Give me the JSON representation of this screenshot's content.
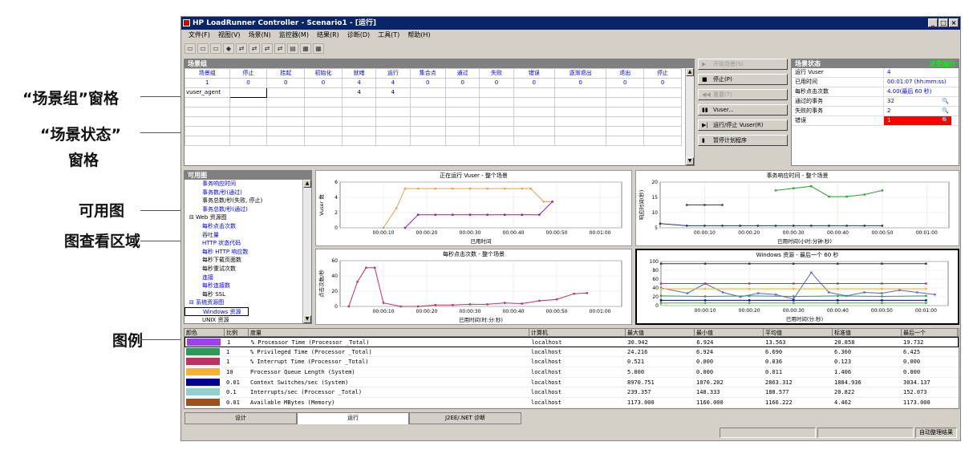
{
  "annotations": [
    {
      "text": "“场景组”窗格"
    },
    {
      "text": "“场景状态”"
    },
    {
      "text": "窗格"
    },
    {
      "text": "可用图"
    },
    {
      "text": "图查看区域"
    },
    {
      "text": "图例"
    }
  ],
  "window": {
    "title": "HP LoadRunner Controller - Scenario1 - [运行]",
    "min": "_",
    "max": "□",
    "close": "×"
  },
  "menu": [
    "文件(F)",
    "视图(V)",
    "场景(N)",
    "监控器(M)",
    "结果(R)",
    "诊断(D)",
    "工具(T)",
    "帮助(H)"
  ],
  "toolbar": [
    "▭",
    "▭",
    "▭",
    "◆",
    "⇄",
    "⇄",
    "⇄",
    "⇄",
    "▤",
    "▦",
    "▦"
  ],
  "groups": {
    "title": "场景组",
    "headers": [
      "场景组",
      "停止",
      "挂起",
      "初始化",
      "就绪",
      "运行",
      "集合点",
      "通过",
      "失败",
      "错误",
      "逐渐退出",
      "退出",
      "停止"
    ],
    "counts": [
      "1",
      "0",
      "0",
      "0",
      "4",
      "4",
      "0",
      "0",
      "0",
      "0",
      "0",
      "0",
      "0"
    ],
    "row": [
      "vuser_agent",
      "",
      "",
      "",
      "4",
      "4",
      "",
      "",
      "",
      "",
      "",
      "",
      ""
    ]
  },
  "controls": [
    {
      "icon": "▶",
      "label": "开始场景(S)",
      "disabled": true
    },
    {
      "icon": "■",
      "label": "停止(P)",
      "disabled": false
    },
    {
      "icon": "◀◀",
      "label": "重置(T)",
      "disabled": true
    },
    {
      "icon": "▮▮",
      "label": "Vuser...",
      "disabled": false
    },
    {
      "icon": "▶|",
      "label": "运行/停止 Vuser(R)",
      "disabled": false
    },
    {
      "icon": "▮",
      "label": "暂停计划程序",
      "disabled": false
    }
  ],
  "status": {
    "title": "场景状态",
    "state": "正在运行",
    "rows": [
      {
        "k": "运行 Vuser",
        "v": "4",
        "mag": ""
      },
      {
        "k": "已用时间",
        "v": "00:01:07 (hh:mm:ss)",
        "mag": ""
      },
      {
        "k": "每秒点击次数",
        "v": "4.00(最后 60 秒)",
        "mag": ""
      },
      {
        "k": "通过的事务",
        "v": "32",
        "mag": "🔍"
      },
      {
        "k": "失败的事务",
        "v": "2",
        "mag": "🔍"
      },
      {
        "k": "错误",
        "v": "1",
        "mag": "🔍",
        "red": true
      }
    ]
  },
  "graphs": {
    "title": "可用图",
    "items": [
      {
        "t": "事务响应时间",
        "c": "b",
        "i": 1
      },
      {
        "t": "事务数/秒(通过)",
        "c": "b",
        "i": 1
      },
      {
        "t": "事务总数/秒(失败, 停止)",
        "c": "k",
        "i": 1
      },
      {
        "t": "事务总数/秒(通过)",
        "c": "b",
        "i": 1
      },
      {
        "t": "⊟ Web 资源图",
        "c": "h",
        "i": 0
      },
      {
        "t": "每秒点击次数",
        "c": "b",
        "i": 1
      },
      {
        "t": "吞吐量",
        "c": "b",
        "i": 1
      },
      {
        "t": "HTTP 状态代码",
        "c": "b",
        "i": 1
      },
      {
        "t": "每秒 HTTP 响应数",
        "c": "b",
        "i": 1
      },
      {
        "t": "每秒下载页面数",
        "c": "k",
        "i": 1
      },
      {
        "t": "每秒重试次数",
        "c": "k",
        "i": 1
      },
      {
        "t": "连接",
        "c": "b",
        "i": 1
      },
      {
        "t": "每秒连接数",
        "c": "b",
        "i": 1
      },
      {
        "t": "每秒 SSL",
        "c": "k",
        "i": 1
      },
      {
        "t": "⊟ 系统资源图",
        "c": "b",
        "i": 0
      },
      {
        "t": "Windows 资源",
        "c": "b",
        "i": 1,
        "sel": true
      },
      {
        "t": "UNIX 资源",
        "c": "k",
        "i": 1
      }
    ]
  },
  "chart_data": [
    {
      "type": "line",
      "title": "正在运行 Vuser - 整个场景",
      "xlabel": "已用时间",
      "ylabel": "Vuser 数",
      "x_ticks": [
        "00:00:10",
        "00:00:20",
        "00:00:30",
        "00:00:40",
        "00:00:50",
        "00:01:00"
      ],
      "y_ticks": [
        "0",
        "2",
        "4",
        "6"
      ],
      "xlim": [
        0,
        65
      ],
      "ylim": [
        0,
        7
      ],
      "series": [
        {
          "color": "#e8a050",
          "points": [
            [
              10,
              0
            ],
            [
              13,
              3
            ],
            [
              15,
              6
            ],
            [
              18,
              6
            ],
            [
              22,
              6
            ],
            [
              26,
              6
            ],
            [
              30,
              6
            ],
            [
              34,
              6
            ],
            [
              38,
              6
            ],
            [
              42,
              6
            ],
            [
              44,
              6
            ],
            [
              47,
              4
            ],
            [
              49,
              4
            ]
          ]
        },
        {
          "color": "#8020c0",
          "points": [
            [
              15,
              0
            ],
            [
              18,
              2
            ],
            [
              22,
              2
            ],
            [
              26,
              2
            ],
            [
              30,
              2
            ],
            [
              34,
              2
            ],
            [
              38,
              2
            ],
            [
              42,
              2
            ],
            [
              46,
              2
            ],
            [
              49,
              4
            ]
          ]
        }
      ]
    },
    {
      "type": "line",
      "title": "事务响应时间 - 整个场景",
      "xlabel": "已用时间(小时:分钟:秒)",
      "ylabel": "响应时间(秒)",
      "x_ticks": [
        "00:00:10",
        "00:00:20",
        "00:00:30",
        "00:00:40",
        "00:00:50",
        "00:01:00"
      ],
      "y_ticks": [
        "5",
        "10",
        "15",
        "20"
      ],
      "xlim": [
        0,
        65
      ],
      "ylim": [
        0,
        22
      ],
      "series": [
        {
          "color": "#30a030",
          "points": [
            [
              26,
              18
            ],
            [
              30,
              19
            ],
            [
              34,
              20
            ],
            [
              38,
              15
            ],
            [
              42,
              15
            ],
            [
              46,
              16
            ],
            [
              50,
              18
            ]
          ]
        },
        {
          "color": "#404040",
          "points": [
            [
              6,
              11
            ],
            [
              10,
              11
            ],
            [
              14,
              11
            ]
          ]
        },
        {
          "color": "#203080",
          "points": [
            [
              0,
              2
            ],
            [
              6,
              1
            ],
            [
              10,
              1
            ],
            [
              14,
              1
            ],
            [
              18,
              1
            ],
            [
              22,
              1
            ],
            [
              26,
              1
            ],
            [
              30,
              1
            ],
            [
              34,
              1
            ],
            [
              38,
              1
            ],
            [
              42,
              1
            ],
            [
              46,
              1
            ],
            [
              50,
              1
            ]
          ]
        }
      ]
    },
    {
      "type": "line",
      "title": "每秒点击次数 - 整个场景",
      "xlabel": "已用时间(时:分:秒)",
      "ylabel": "点击次数/秒",
      "x_ticks": [
        "00:00:10",
        "00:00:20",
        "00:00:30",
        "00:00:40",
        "00:00:50",
        "00:01:00"
      ],
      "y_ticks": [
        "0",
        "20",
        "40",
        "60"
      ],
      "xlim": [
        0,
        65
      ],
      "ylim": [
        0,
        65
      ],
      "series": [
        {
          "color": "#c0306a",
          "points": [
            [
              2,
              0
            ],
            [
              4,
              35
            ],
            [
              6,
              55
            ],
            [
              8,
              55
            ],
            [
              10,
              5
            ],
            [
              14,
              0
            ],
            [
              18,
              0
            ],
            [
              22,
              2
            ],
            [
              26,
              2
            ],
            [
              30,
              3
            ],
            [
              34,
              3
            ],
            [
              38,
              5
            ],
            [
              42,
              4
            ],
            [
              46,
              8
            ],
            [
              50,
              10
            ],
            [
              54,
              18
            ],
            [
              57,
              19
            ]
          ]
        }
      ]
    },
    {
      "type": "line",
      "title": "Windows 资源 - 最后一个 60 秒",
      "xlabel": "已用时间(分:秒)",
      "ylabel": "",
      "x_ticks": [
        "00:00:10",
        "00:00:20",
        "00:00:30",
        "00:00:40",
        "00:00:50",
        "00:01:00"
      ],
      "y_ticks": [
        "0",
        "20",
        "40",
        "60",
        "80",
        "100"
      ],
      "xlim": [
        0,
        65
      ],
      "ylim": [
        0,
        100
      ],
      "series": [
        {
          "color": "#333333",
          "points": [
            [
              0,
              95
            ],
            [
              10,
              95
            ],
            [
              20,
              95
            ],
            [
              30,
              95
            ],
            [
              40,
              95
            ],
            [
              50,
              95
            ],
            [
              60,
              95
            ]
          ]
        },
        {
          "color": "#6060e0",
          "points": [
            [
              0,
              40
            ],
            [
              6,
              28
            ],
            [
              10,
              50
            ],
            [
              14,
              30
            ],
            [
              18,
              20
            ],
            [
              22,
              28
            ],
            [
              26,
              25
            ],
            [
              30,
              15
            ],
            [
              34,
              75
            ],
            [
              38,
              30
            ],
            [
              42,
              22
            ],
            [
              46,
              30
            ],
            [
              50,
              28
            ],
            [
              54,
              35
            ],
            [
              58,
              30
            ],
            [
              62,
              25
            ]
          ]
        },
        {
          "color": "#c03060",
          "points": [
            [
              0,
              50
            ],
            [
              10,
              50
            ],
            [
              20,
              50
            ],
            [
              30,
              50
            ],
            [
              40,
              50
            ],
            [
              50,
              50
            ],
            [
              60,
              50
            ]
          ]
        },
        {
          "color": "#ffb030",
          "points": [
            [
              0,
              38
            ],
            [
              10,
              38
            ],
            [
              20,
              38
            ],
            [
              30,
              38
            ],
            [
              40,
              38
            ],
            [
              50,
              38
            ],
            [
              60,
              38
            ]
          ]
        },
        {
          "color": "#2a9a5a",
          "points": [
            [
              0,
              22
            ],
            [
              10,
              21
            ],
            [
              20,
              22
            ],
            [
              30,
              21
            ],
            [
              40,
              22
            ],
            [
              50,
              21
            ],
            [
              60,
              22
            ]
          ]
        },
        {
          "color": "#000090",
          "points": [
            [
              0,
              12
            ],
            [
              10,
              12
            ],
            [
              20,
              12
            ],
            [
              30,
              12
            ],
            [
              40,
              12
            ],
            [
              50,
              12
            ],
            [
              60,
              12
            ]
          ]
        },
        {
          "color": "#20c020",
          "points": [
            [
              0,
              6
            ],
            [
              10,
              6
            ],
            [
              20,
              6
            ],
            [
              30,
              6
            ],
            [
              40,
              6
            ],
            [
              50,
              6
            ],
            [
              60,
              6
            ]
          ]
        }
      ]
    }
  ],
  "legend": {
    "headers": [
      "颜色",
      "比例",
      "度量",
      "计算机",
      "最大值",
      "最小值",
      "平均值",
      "标准值",
      "最后一个"
    ],
    "rows": [
      {
        "color": "#a040f0",
        "scale": "1",
        "measure": "% Processor Time (Processor _Total)",
        "machine": "localhost",
        "max": "30.942",
        "min": "6.924",
        "avg": "13.563",
        "std": "20.858",
        "last": "19.732",
        "sel": true
      },
      {
        "color": "#2a9a5a",
        "scale": "1",
        "measure": "% Privileged Time (Processor _Total)",
        "machine": "localhost",
        "max": "24.216",
        "min": "6.924",
        "avg": "6.690",
        "std": "6.360",
        "last": "6.425"
      },
      {
        "color": "#c03060",
        "scale": "1",
        "measure": "% Interrupt Time (Processor _Total)",
        "machine": "localhost",
        "max": "0.521",
        "min": "0.000",
        "avg": "0.036",
        "std": "0.123",
        "last": "0.000"
      },
      {
        "color": "#ffb030",
        "scale": "10",
        "measure": "Processor Queue Length (System)",
        "machine": "localhost",
        "max": "5.000",
        "min": "0.000",
        "avg": "0.011",
        "std": "1.406",
        "last": "0.000"
      },
      {
        "color": "#000090",
        "scale": "0.01",
        "measure": "Context Switches/sec (System)",
        "machine": "localhost",
        "max": "8970.751",
        "min": "1070.202",
        "avg": "2863.312",
        "std": "1884.936",
        "last": "3034.137"
      },
      {
        "color": "#90d0d0",
        "scale": "0.1",
        "measure": "Interrupts/sec (Processor _Total)",
        "machine": "localhost",
        "max": "239.357",
        "min": "148.333",
        "avg": "188.577",
        "std": "20.822",
        "last": "152.073"
      },
      {
        "color": "#a05020",
        "scale": "0.01",
        "measure": "Available MBytes (Memory)",
        "machine": "localhost",
        "max": "1173.000",
        "min": "1160.000",
        "avg": "1166.222",
        "std": "4.462",
        "last": "1173.000"
      }
    ]
  },
  "tabs": [
    {
      "label": "设计",
      "active": false
    },
    {
      "label": "运行",
      "active": true
    },
    {
      "label": "J2EE/.NET 诊断",
      "active": false
    }
  ],
  "statusbar": {
    "autocollate": "自动整理结果"
  }
}
